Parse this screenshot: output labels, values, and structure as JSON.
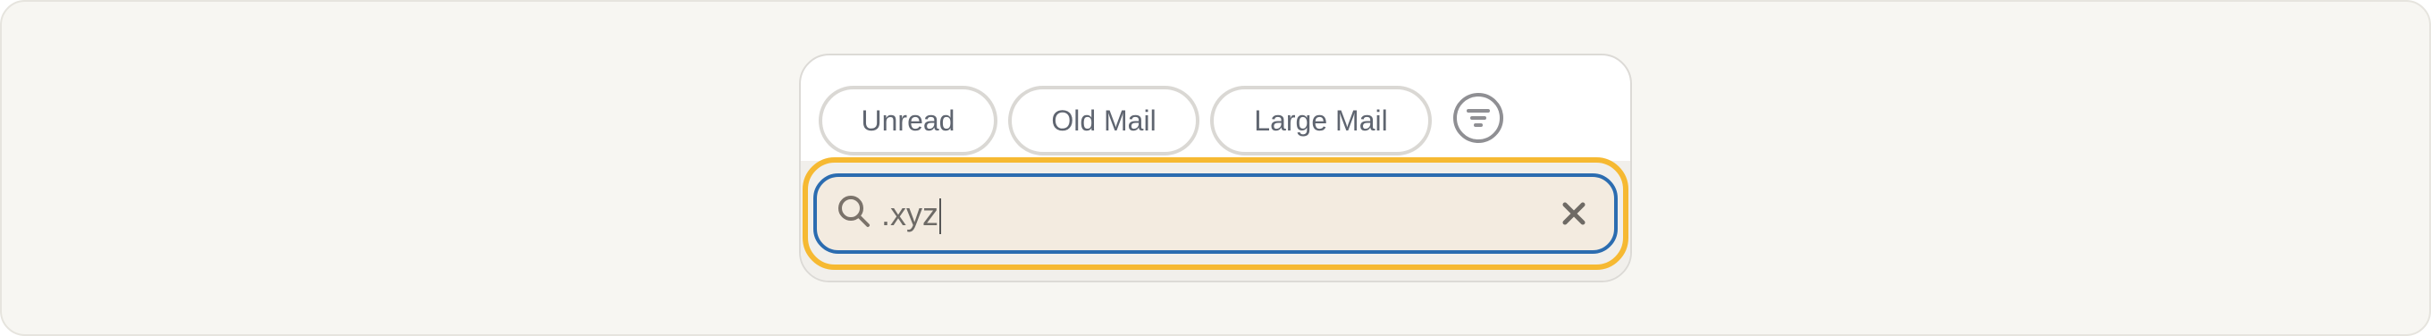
{
  "filter_chips": [
    {
      "label": "Unread"
    },
    {
      "label": "Old Mail"
    },
    {
      "label": "Large Mail"
    }
  ],
  "filter_button": {
    "icon": "filter-icon"
  },
  "search": {
    "value": ".xyz",
    "search_icon": "search-icon",
    "clear_icon": "close-icon",
    "focused": true
  },
  "colors": {
    "focus_ring": "#f6b932",
    "field_border": "#2b6cb0",
    "field_background": "#f3ebe0",
    "page_background": "#f7f6f2"
  }
}
